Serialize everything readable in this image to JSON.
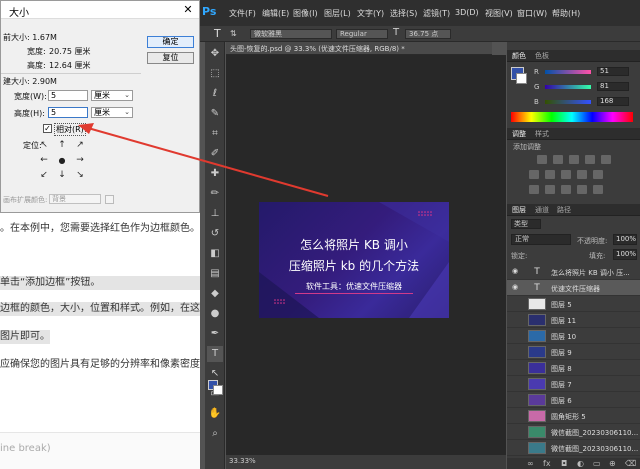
{
  "article": {
    "line1": "。在本例中，您需要选择红色作为边框颜色。",
    "line2": "单击“添加边框”按钮。",
    "line3": "边框的颜色，大小，位置和样式。例如，在这",
    "line4": "图片即可。",
    "line5": "应确保您的图片具有足够的分辨率和像素密度",
    "footer": "ine break)"
  },
  "dialog": {
    "title": "大小",
    "close": "✕",
    "current_size": "前大小: 1.67M",
    "cur_width_label": "宽度:",
    "cur_width_value": "20.75 厘米",
    "cur_height_label": "高度:",
    "cur_height_value": "12.64 厘米",
    "new_size": "建大小: 2.90M",
    "width_label": "宽度(W):",
    "width_value": "5",
    "width_unit": "厘米",
    "height_label": "高度(H):",
    "height_value": "5",
    "height_unit": "厘米",
    "relative_label": "相对(R)",
    "relative_checked": "✓",
    "anchor_label": "定位:",
    "ext_label": "画布扩展颜色:",
    "ext_value": "背景",
    "ok": "确定",
    "reset": "复位"
  },
  "ps": {
    "logo": "Ps",
    "menus": [
      "文件(F)",
      "编辑(E)",
      "图像(I)",
      "图层(L)",
      "文字(Y)",
      "选择(S)",
      "滤镜(T)",
      "3D(D)",
      "视图(V)",
      "窗口(W)",
      "帮助(H)"
    ],
    "font_family": "微软雅黑",
    "font_style": "Regular",
    "font_size": "36.75 点",
    "doc_tab": "头图-恢复的.psd @ 33.3% (优速文件压缩器, RGB/8) *",
    "zoom": "33.33%",
    "image_line1": "怎么将照片 KB 调小",
    "image_line2": "压缩照片 kb 的几个方法",
    "image_line3": "软件工具：优速文件压缩器"
  },
  "panels": {
    "color_tabs": [
      "颜色",
      "色板"
    ],
    "channels": [
      {
        "label": "R",
        "value": "51"
      },
      {
        "label": "G",
        "value": "81"
      },
      {
        "label": "B",
        "value": "168"
      }
    ],
    "adj_tabs": [
      "调整",
      "样式"
    ],
    "adj_title": "添加调整",
    "layer_tabs": [
      "图层",
      "通道",
      "路径"
    ],
    "kind_label": "类型",
    "blend_mode": "正常",
    "opacity_label": "不透明度:",
    "opacity_value": "100%",
    "lock_label": "锁定:",
    "fill_label": "填充:",
    "fill_value": "100%",
    "layers": [
      {
        "name": "怎么将照片 KB 调小 压..."
      },
      {
        "name": "优速文件压缩器"
      },
      {
        "name": "图层 5"
      },
      {
        "name": "图层 11"
      },
      {
        "name": "图层 10"
      },
      {
        "name": "图层 9"
      },
      {
        "name": "图层 8"
      },
      {
        "name": "图层 7"
      },
      {
        "name": "图层 6"
      },
      {
        "name": "圆角矩形 5"
      },
      {
        "name": "微信截图_20230306110..."
      },
      {
        "name": "微信截图_20230306110..."
      }
    ],
    "colors": {
      "foreground": "#3351a8",
      "arrow": "#e03a2f"
    }
  }
}
